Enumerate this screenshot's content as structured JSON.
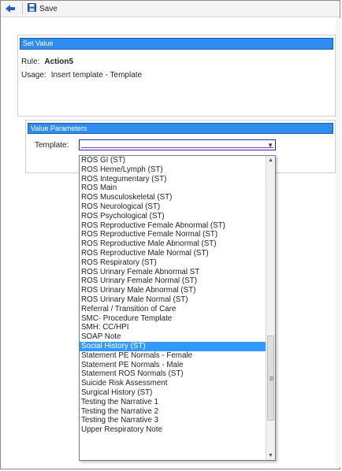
{
  "toolbar": {
    "save_label": "Save"
  },
  "panel": {
    "header": "Set Value",
    "rule_label": "Rule:",
    "rule_value": "Action5",
    "usage_label": "Usage:",
    "usage_value": "Insert template - Template"
  },
  "panel2": {
    "header": "Value Parameters"
  },
  "template_field": {
    "label": "Template:",
    "value": ""
  },
  "dropdown": {
    "items": [
      "ROS GI (ST)",
      "ROS Heme/Lymph (ST)",
      "ROS Integumentary (ST)",
      "ROS Main",
      "ROS Musculoskeletal (ST)",
      "ROS Neurological (ST)",
      "ROS Psychological (ST)",
      "ROS Reproductive Female Abnormal (ST)",
      "ROS Reproductive Female Normal (ST)",
      "ROS Reproductive Male Abnormal (ST)",
      "ROS Reproductive Male Normal (ST)",
      "ROS Respiratory (ST)",
      "ROS Urinary Female Abnormal ST",
      "ROS Urinary Female Normal (ST)",
      "ROS Urinary Male Abnormal (ST)",
      "ROS Urinary Male Normal (ST)",
      "Referral / Transition of Care",
      "SMC- Procedure Template",
      "SMH: CC/HPI",
      "SOAP Note",
      "Social History (ST)",
      "Statement PE Normals - Female",
      "Statement PE Normals - Male",
      "Statement ROS Normals (ST)",
      "Suicide Risk Assessment",
      "Surgical History (ST)",
      "Testing the Narrative 1",
      "Testing the Narrative 2",
      "Testing the Narrative 3",
      "Upper Respiratory Note"
    ],
    "selected_index": 20
  },
  "icons": {
    "back": "back-arrow-icon",
    "save": "floppy-disk-icon",
    "dropdown_arrow": "chevron-down-icon",
    "scroll_up": "scroll-up-arrow-icon",
    "scroll_down": "scroll-down-arrow-icon"
  },
  "colors": {
    "header_blue": "#2f8df0",
    "selection_blue": "#3399ff",
    "back_arrow_blue": "#1f63c9"
  }
}
